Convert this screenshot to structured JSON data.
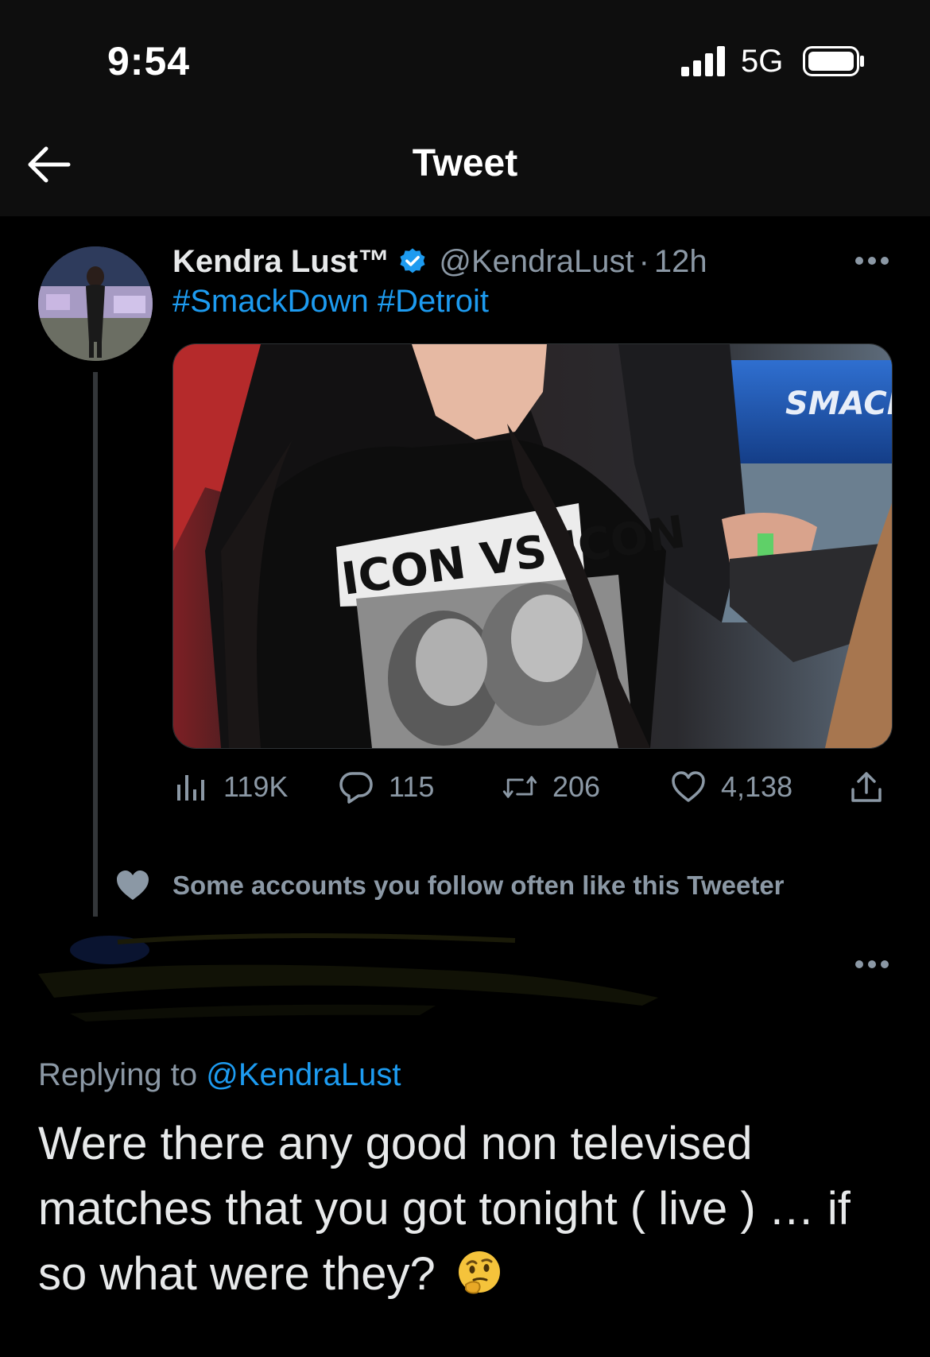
{
  "status_bar": {
    "time": "9:54",
    "network": "5G"
  },
  "nav": {
    "title": "Tweet"
  },
  "tweet": {
    "author_name": "Kendra Lust™",
    "handle": "@KendraLust",
    "separator": "·",
    "time_ago": "12h",
    "hashtags": [
      "#SmackDown",
      "#Detroit"
    ],
    "media_text": "SMACK",
    "shirt_text": "ICON VS ICON",
    "stats": {
      "views": "119K",
      "replies": "115",
      "retweets": "206",
      "likes": "4,138"
    }
  },
  "social_context": {
    "text": "Some accounts you follow often like this Tweeter"
  },
  "reply": {
    "replying_prefix": "Replying to",
    "replying_mention": "@KendraLust",
    "text": "Were there any good non televised matches that you got tonight ( live ) … if so what were they?",
    "emoji": "thinking-face-icon"
  },
  "colors": {
    "background": "#000000",
    "bar_background": "#0e0e0e",
    "accent": "#1d9bf0",
    "secondary_text": "#8b98a5",
    "primary_text": "#e7e9ea"
  }
}
